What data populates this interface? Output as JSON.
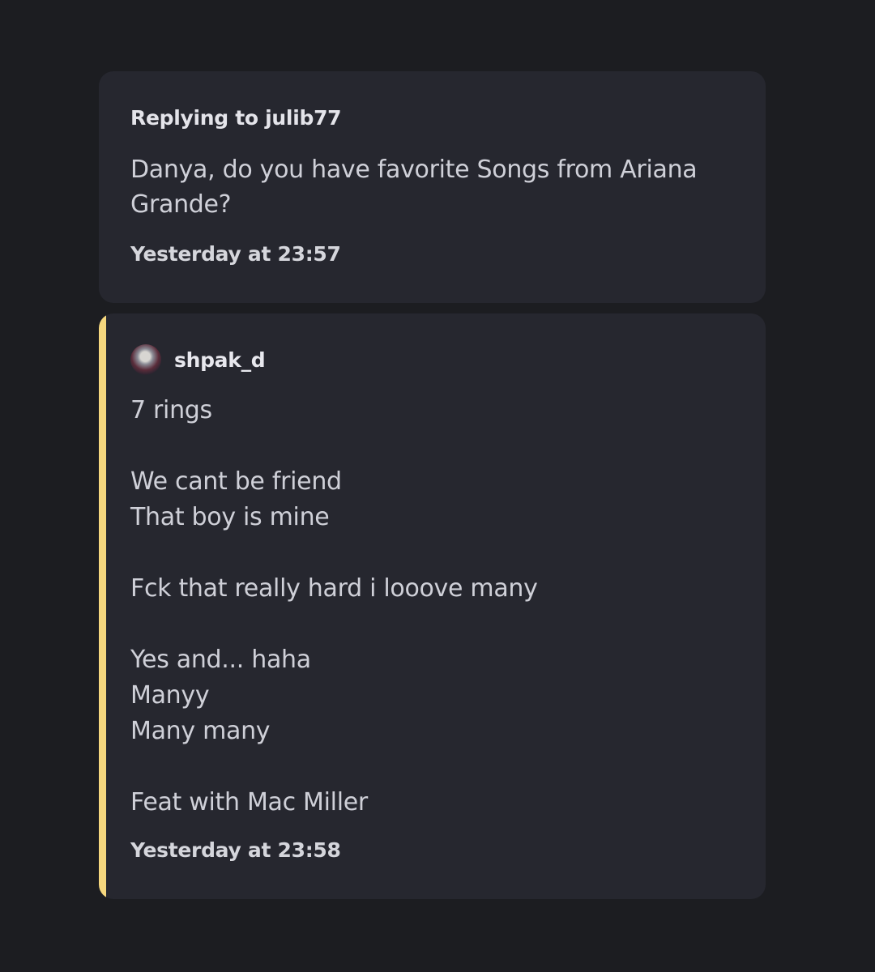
{
  "reply": {
    "label": "Replying to julib77",
    "text": "Danya, do you have favorite Songs from Ariana Grande?",
    "timestamp": "Yesterday at 23:57"
  },
  "message": {
    "author": "shpak_d",
    "lines": [
      "7 rings",
      "",
      "We cant be friend",
      "That boy is mine",
      "",
      "Fck that really hard i looove many",
      "",
      "Yes and... haha",
      "Manyy",
      "Many many",
      "",
      "Feat with Mac Miller"
    ],
    "timestamp": "Yesterday at 23:58",
    "accent_color": "#f5d77e"
  },
  "colors": {
    "background": "#1c1d21",
    "card": "#26272f",
    "text": "#cfd0d8"
  }
}
